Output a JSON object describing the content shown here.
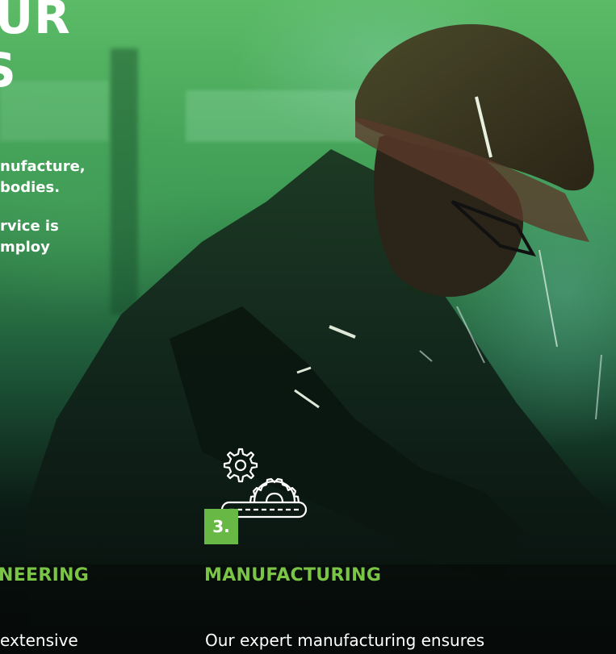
{
  "hero": {
    "title_lines": [
      "UR",
      "S"
    ],
    "paragraph1_lines": [
      "nufacture,",
      "bodies."
    ],
    "paragraph2_lines": [
      "rvice is",
      "mploy"
    ]
  },
  "steps": {
    "left": {
      "title": "NEERING",
      "description": "extensive"
    },
    "main": {
      "number": "3.",
      "icon": "gears-conveyor-icon",
      "title": "MANUFACTURING",
      "description": "Our expert manufacturing ensures"
    }
  },
  "colors": {
    "accent_green": "#7ac545",
    "badge_green": "#67b845",
    "text_white": "#ffffff"
  }
}
